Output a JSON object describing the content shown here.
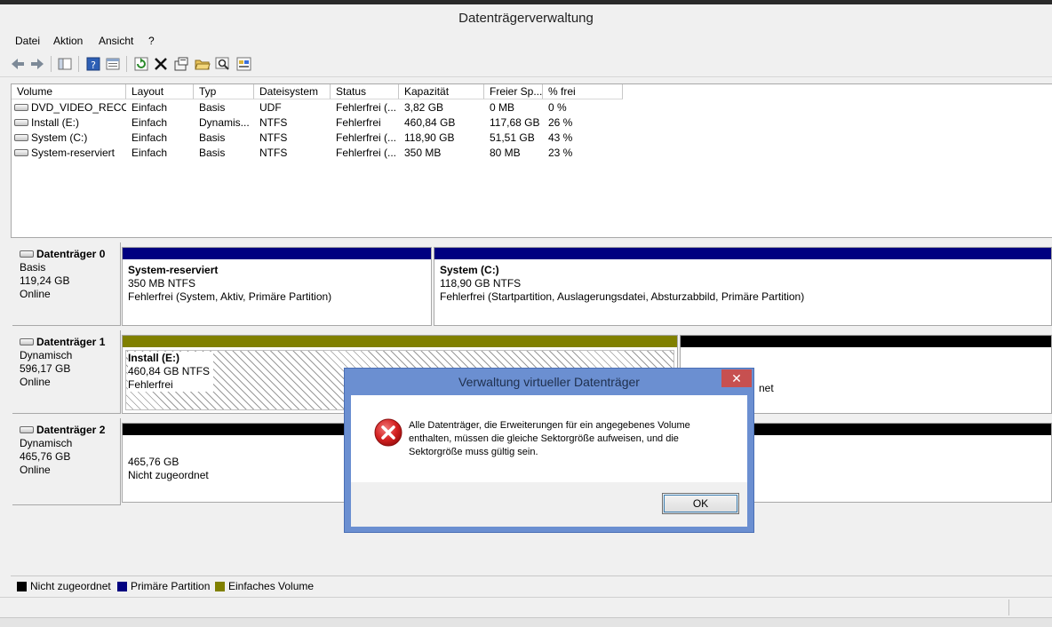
{
  "window": {
    "title": "Datenträgerverwaltung"
  },
  "menu": [
    "Datei",
    "Aktion",
    "Ansicht",
    "?"
  ],
  "toolbar_icons": [
    "back-icon",
    "forward-icon",
    "console-tree-icon",
    "help-icon",
    "properties-icon",
    "refresh-icon",
    "delete-icon",
    "settings-icon",
    "open-folder-icon",
    "search-icon",
    "action-icon"
  ],
  "volumes": {
    "columns": [
      "Volume",
      "Layout",
      "Typ",
      "Dateisystem",
      "Status",
      "Kapazität",
      "Freier Sp...",
      "% frei"
    ],
    "rows": [
      [
        "DVD_VIDEO_RECO...",
        "Einfach",
        "Basis",
        "UDF",
        "Fehlerfrei (...",
        "3,82 GB",
        "0 MB",
        "0 %"
      ],
      [
        "Install (E:)",
        "Einfach",
        "Dynamis...",
        "NTFS",
        "Fehlerfrei",
        "460,84 GB",
        "117,68 GB",
        "26 %"
      ],
      [
        "System (C:)",
        "Einfach",
        "Basis",
        "NTFS",
        "Fehlerfrei (...",
        "118,90 GB",
        "51,51 GB",
        "43 %"
      ],
      [
        "System-reserviert",
        "Einfach",
        "Basis",
        "NTFS",
        "Fehlerfrei (...",
        "350 MB",
        "80 MB",
        "23 %"
      ]
    ]
  },
  "disks": [
    {
      "name": "Datenträger 0",
      "type": "Basis",
      "size": "119,24 GB",
      "state": "Online",
      "partitions": [
        {
          "title": "System-reserviert",
          "size": "350 MB NTFS",
          "status": "Fehlerfrei (System, Aktiv, Primäre Partition)"
        },
        {
          "title": "System  (C:)",
          "size": "118,90 GB NTFS",
          "status": "Fehlerfrei (Startpartition, Auslagerungsdatei, Absturzabbild, Primäre Partition)"
        }
      ]
    },
    {
      "name": "Datenträger 1",
      "type": "Dynamisch",
      "size": "596,17 GB",
      "state": "Online",
      "partitions": [
        {
          "title": "Install  (E:)",
          "size": "460,84 GB NTFS",
          "status": "Fehlerfrei"
        },
        {
          "title": "",
          "size": "",
          "status": "net"
        }
      ]
    },
    {
      "name": "Datenträger 2",
      "type": "Dynamisch",
      "size": "465,76 GB",
      "state": "Online",
      "partitions": [
        {
          "title": "",
          "size": "465,76 GB",
          "status": "Nicht zugeordnet"
        }
      ]
    }
  ],
  "legend": [
    {
      "label": "Nicht zugeordnet",
      "color": "#000000"
    },
    {
      "label": "Primäre Partition",
      "color": "#000080"
    },
    {
      "label": "Einfaches Volume",
      "color": "#808000"
    }
  ],
  "dialog": {
    "title": "Verwaltung virtueller Datenträger",
    "close": "✕",
    "message": "Alle Datenträger, die Erweiterungen für ein angegebenes Volume enthalten, müssen die gleiche  Sektorgröße aufweisen, und die Sektorgröße muss gültig sein.",
    "ok_label": "OK",
    "icon": "error-icon"
  },
  "colors": {
    "primary": "#000080",
    "simple": "#808000",
    "unallocated": "#000000",
    "dialog_frame": "#6b8fd1",
    "close": "#c75050"
  }
}
